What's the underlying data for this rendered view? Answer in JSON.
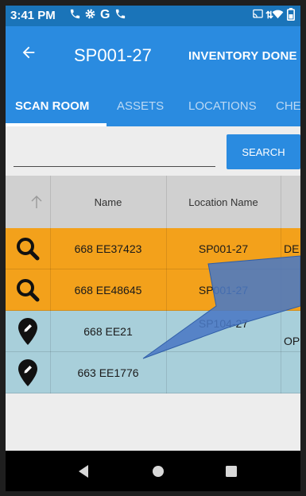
{
  "status_bar": {
    "time": "3:41 PM",
    "icons": [
      "phone-icon",
      "gear-icon",
      "google-g-icon",
      "phone-icon",
      "cast-icon",
      "wifi-icon",
      "battery-icon"
    ]
  },
  "app_bar": {
    "back_icon": "arrow-back-icon",
    "title": "SP001-27",
    "action": "INVENTORY DONE"
  },
  "tabs": [
    "SCAN ROOM",
    "ASSETS",
    "LOCATIONS",
    "CHE"
  ],
  "search": {
    "value": "",
    "button": "SEARCH"
  },
  "table": {
    "columns": [
      "",
      "Name",
      "Location Name",
      ""
    ],
    "rows": [
      {
        "icon": "search-icon",
        "name": "668 EE37423",
        "location": "SP001-27",
        "extra": "DE",
        "status": "orange"
      },
      {
        "icon": "search-icon",
        "name": "668 EE48645",
        "location": "SP001-27",
        "extra": "",
        "status": "orange"
      },
      {
        "icon": "pencil-pin-icon",
        "name": "668 EE21",
        "location": "SP104-27",
        "extra": "OPH",
        "status": "blue"
      },
      {
        "icon": "pencil-pin-icon",
        "name": "663 EE1776",
        "location": "",
        "extra": "",
        "status": "blue"
      }
    ]
  },
  "colors": {
    "primary": "#2a8be0",
    "status_bar": "#1a74b9",
    "orange_row": "#f3a11b",
    "blue_row": "#a8cfda",
    "callout": "#4a79c4"
  },
  "nav_bar": {
    "icons": [
      "back-triangle-icon",
      "home-circle-icon",
      "recents-square-icon"
    ]
  }
}
